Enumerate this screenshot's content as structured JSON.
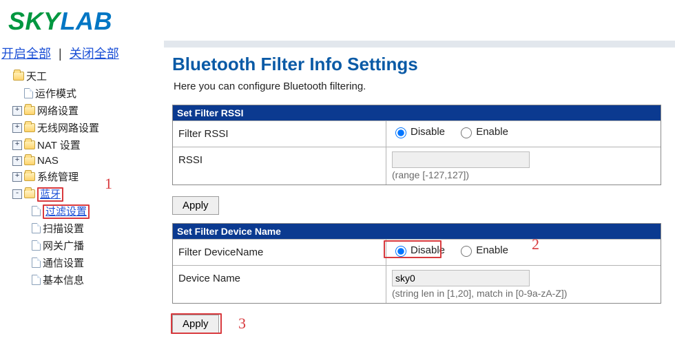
{
  "brand": {
    "sky": "SKY",
    "lab": "LAB"
  },
  "side_actions": {
    "open_all": "开启全部",
    "close_all": "关闭全部"
  },
  "tree": {
    "root": "天工",
    "n1": "运作模式",
    "n2": "网络设置",
    "n3": "无线网路设置",
    "n4": "NAT 设置",
    "n5": "NAS",
    "n6": "系统管理",
    "bt": "蓝牙",
    "bt_children": {
      "filter": "过滤设置",
      "scan": "扫描设置",
      "gw": "网关广播",
      "comm": "通信设置",
      "info": "基本信息"
    }
  },
  "main": {
    "title": "Bluetooth Filter Info Settings",
    "desc": "Here you can configure Bluetooth filtering.",
    "section_rssi": {
      "hd": "Set Filter RSSI",
      "row1_label": "Filter RSSI",
      "disable": "Disable",
      "enable": "Enable",
      "row2_label": "RSSI",
      "row2_hint": "(range [-127,127])",
      "rssi_value": "",
      "apply": "Apply"
    },
    "section_dev": {
      "hd": "Set Filter Device Name",
      "row1_label": "Filter DeviceName",
      "disable": "Disable",
      "enable": "Enable",
      "row2_label": "Device Name",
      "device_name_value": "sky0",
      "row2_hint": "(string len in [1,20], match in [0-9a-zA-Z])",
      "apply": "Apply"
    }
  },
  "annotations": {
    "a1": "1",
    "a2": "2",
    "a3": "3"
  }
}
